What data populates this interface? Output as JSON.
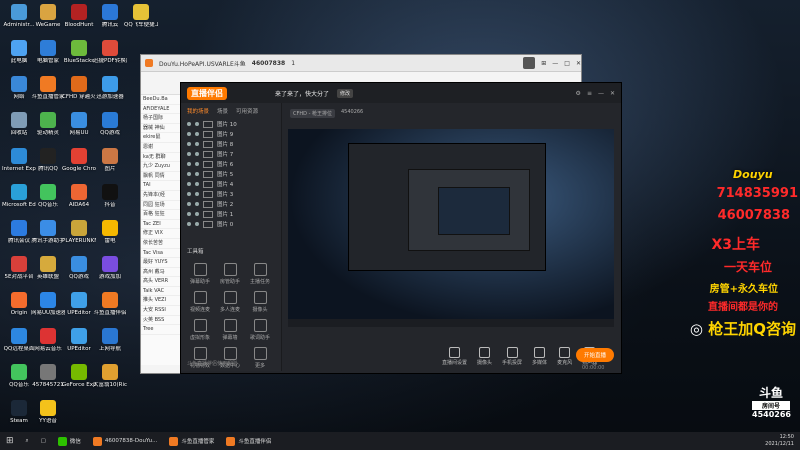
{
  "desktop_icons": [
    {
      "label": "Administr...",
      "color": "#4a9ad9"
    },
    {
      "label": "WeGame",
      "color": "#d9a441"
    },
    {
      "label": "BloodHunt",
      "color": "#b32222"
    },
    {
      "label": "腾讯云",
      "color": "#2b78d8"
    },
    {
      "label": "QQ飞车便捷工具",
      "color": "#e6c237"
    },
    {
      "label": "此电脑",
      "color": "#4ea3f2"
    },
    {
      "label": "电脑管家",
      "color": "#2e7dd8"
    },
    {
      "label": "BlueStacks",
      "color": "#6dbb3c"
    },
    {
      "label": "迅捷PDF转换器",
      "color": "#e04b3a"
    },
    {
      "label": "网络",
      "color": "#3a88d8"
    },
    {
      "label": "斗鱼直播管家",
      "color": "#f07a23"
    },
    {
      "label": "CFHD 穿越火线",
      "color": "#e06a1a"
    },
    {
      "label": "迅游加速器",
      "color": "#3d9be9"
    },
    {
      "label": "回收站",
      "color": "#7f9cb6"
    },
    {
      "label": "驱动精灵",
      "color": "#4db34d"
    },
    {
      "label": "网易UU",
      "color": "#3a8ee0"
    },
    {
      "label": "QQ游戏",
      "color": "#2a7bd6"
    },
    {
      "label": "Internet Explorer",
      "color": "#2d8bd8"
    },
    {
      "label": "腾讯QQ",
      "color": "#222"
    },
    {
      "label": "Google Chrome",
      "color": "#e34133"
    },
    {
      "label": "图片",
      "color": "#c74"
    },
    {
      "label": "Microsoft Edge",
      "color": "#2aa0d8"
    },
    {
      "label": "QQ音乐",
      "color": "#43c45d"
    },
    {
      "label": "AIDA64",
      "color": "#e63"
    },
    {
      "label": "抖音",
      "color": "#111"
    },
    {
      "label": "腾讯会议",
      "color": "#2c7be0"
    },
    {
      "label": "腾讯手游助手",
      "color": "#3b8de6"
    },
    {
      "label": "PLAYERUNKNOWN'S BATTLEGR...",
      "color": "#c9a53a"
    },
    {
      "label": "雷电",
      "color": "#f5b800"
    },
    {
      "label": "5E对战平台",
      "color": "#d8403a"
    },
    {
      "label": "英雄联盟",
      "color": "#d6aa3c"
    },
    {
      "label": "QQ游戏",
      "color": "#3a8ee0"
    },
    {
      "label": "游戏加加",
      "color": "#7a4de0"
    },
    {
      "label": "Origin",
      "color": "#f56c2d"
    },
    {
      "label": "网易UU加速器",
      "color": "#2c86e6"
    },
    {
      "label": "UPEditor",
      "color": "#3fa0e8"
    },
    {
      "label": "斗鱼直播伴侣",
      "color": "#f07a23"
    },
    {
      "label": "QQ远程桌面",
      "color": "#2d87e0"
    },
    {
      "label": "网易云音乐",
      "color": "#d33"
    },
    {
      "label": "UPEditor",
      "color": "#3fa0e8"
    },
    {
      "label": "上网导航",
      "color": "#2a77d2"
    },
    {
      "label": "QQ音乐",
      "color": "#43c45d"
    },
    {
      "label": "457845721",
      "color": "#777"
    },
    {
      "label": "GeForce Experience",
      "color": "#76b900"
    },
    {
      "label": "大富翁10(Rich10)",
      "color": "#e0a030"
    },
    {
      "label": "Steam",
      "color": "#1b2838"
    },
    {
      "label": "YY语音",
      "color": "#f4c21b"
    },
    {
      "label": "QQ飞车",
      "color": "#2a9de0"
    }
  ],
  "back_window": {
    "title": "DouYu.HoPeAPI.USVARLE斗鱼",
    "room": "46007838",
    "count": "1",
    "chat": [
      "BeeDu.Ba",
      "AFiDEYALE",
      "杨子国际",
      "器械 神仙",
      "ekire鼠",
      "恩谢",
      "ka无 群聊",
      "九少 Zuyzu",
      "飘帆 同情",
      "TAI",
      "先锋本(经",
      "同园 狂场",
      "百格 狂狂",
      "Tac ZEI",
      "修正 VIX",
      "依长苦苦",
      "Tac Visa",
      "最好 YUYS",
      "高州 戴马",
      "高头 VERR",
      "Talk VAC",
      "推头 VEZI",
      "大安 RSSI",
      "火英 BSS",
      "Tree"
    ]
  },
  "app": {
    "logo": "直播伴侣",
    "tabs": [
      "我的场景",
      "场景",
      "可用资源"
    ],
    "scenes": [
      "图片 10",
      "图片 9",
      "图片 8",
      "图片 7",
      "图片 6",
      "图片 5",
      "图片 4",
      "图片 3",
      "图片 2",
      "图片 1",
      "图片 0"
    ],
    "tools_title": "工具箱",
    "tools": [
      "弹幕助手",
      "房管助手",
      "主播任务",
      "视频连麦",
      "多人连麦",
      "摄像头",
      "虚拟形象",
      "弹幕墙",
      "歌词助手",
      "礼物特效",
      "数据中心",
      "更多"
    ],
    "stream_title": "来了来了，快大分了",
    "stream_tag": "修改",
    "category": "CFHD - 枪王排位",
    "viewers": "4540266",
    "notice": "斗鱼直播伴侣使用规则",
    "bottom": [
      "直播间设置",
      "摄像头",
      "手机投屏",
      "多媒体",
      "麦克风",
      "扬声器"
    ],
    "start_btn": "开始直播",
    "time": "00:00:00"
  },
  "overlays": {
    "douyu_logo": "Douyu",
    "line1": "714835991",
    "line2": "46007838",
    "line3": "X3上车",
    "line4": "一天车位",
    "line5": "房管+永久车位",
    "line6": "直播间都是你的",
    "line7": "枪王加Q咨询",
    "room_badge": "斗鱼",
    "room_badge2": "房间号",
    "room_id": "4540266"
  },
  "taskbar": {
    "items": [
      {
        "label": "微信",
        "color": "#2dc100"
      },
      {
        "label": "46007838-DouYu...",
        "color": "#f07a23"
      },
      {
        "label": "斗鱼直播管家",
        "color": "#f07a23"
      },
      {
        "label": "斗鱼直播伴侣",
        "color": "#f07a23"
      }
    ],
    "time": "12:50",
    "date": "2021/12/11"
  },
  "colors": {
    "accent": "#ff7a00",
    "overlay_red": "#ff2a2a",
    "overlay_yellow": "#ffd400"
  }
}
